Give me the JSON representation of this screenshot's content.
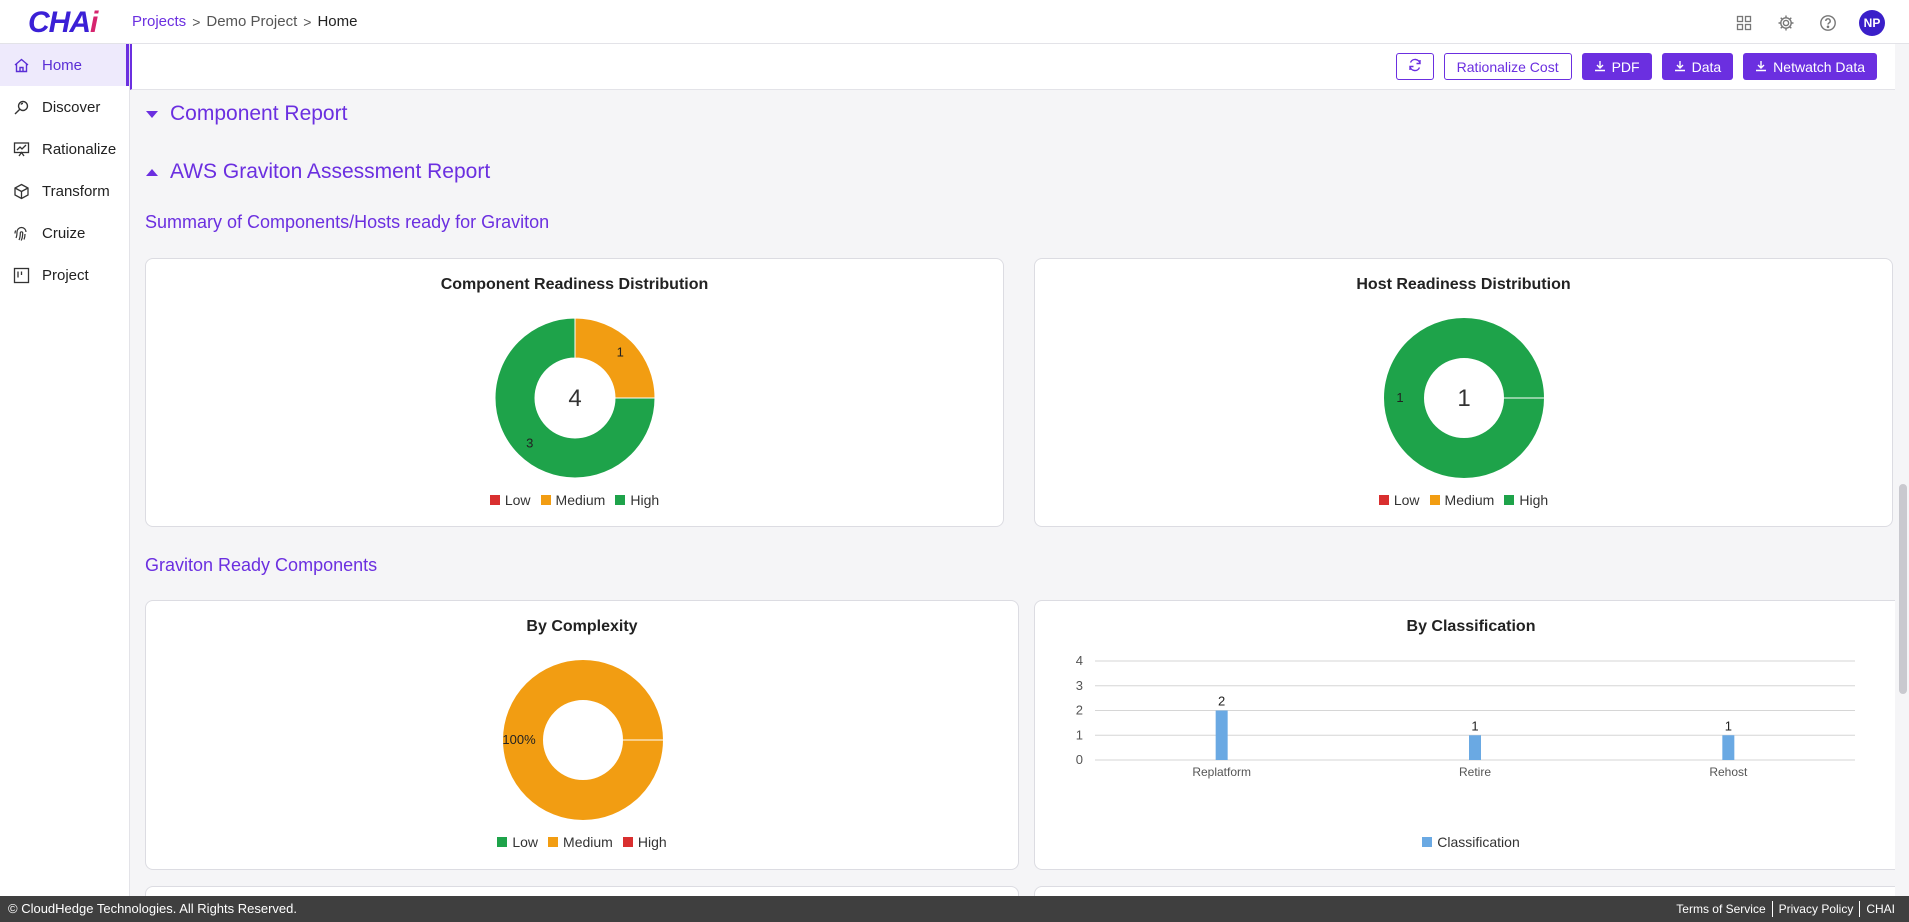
{
  "header": {
    "logo": {
      "main": "CHA",
      "accent": "i"
    },
    "breadcrumb": [
      "Projects",
      "Demo Project",
      "Home"
    ],
    "avatar_initials": "NP",
    "icons": [
      "grid-icon",
      "gear-icon",
      "help-icon"
    ]
  },
  "sidebar": {
    "items": [
      {
        "label": "Home",
        "icon": "home-icon",
        "active": true
      },
      {
        "label": "Discover",
        "icon": "discover-icon",
        "active": false
      },
      {
        "label": "Rationalize",
        "icon": "rationalize-icon",
        "active": false
      },
      {
        "label": "Transform",
        "icon": "cube-icon",
        "active": false
      },
      {
        "label": "Cruize",
        "icon": "fingerprint-icon",
        "active": false
      },
      {
        "label": "Project",
        "icon": "board-icon",
        "active": false
      }
    ]
  },
  "toolbar": {
    "refresh_icon": "refresh-icon",
    "rationalize_cost": "Rationalize Cost",
    "pdf": "PDF",
    "data": "Data",
    "netwatch": "Netwatch Data"
  },
  "sections": {
    "component_report": "Component Report",
    "graviton_report": "AWS Graviton Assessment Report",
    "summary_heading": "Summary of Components/Hosts ready for Graviton",
    "ready_heading": "Graviton Ready Components"
  },
  "colors": {
    "accent": "#6b2fe0",
    "low": "#d92f2f",
    "medium": "#f29d12",
    "high": "#1ea34a",
    "bar": "#6aa9e3"
  },
  "chart_data": [
    {
      "type": "pie",
      "title": "Component Readiness Distribution",
      "center_label": "4",
      "categories": [
        "Low",
        "Medium",
        "High"
      ],
      "values": [
        0,
        1,
        3
      ],
      "slice_labels": [
        "",
        "1",
        "3"
      ],
      "colors": [
        "#d92f2f",
        "#f29d12",
        "#1ea34a"
      ]
    },
    {
      "type": "pie",
      "title": "Host Readiness Distribution",
      "center_label": "1",
      "categories": [
        "Low",
        "Medium",
        "High"
      ],
      "values": [
        0,
        0,
        1
      ],
      "slice_labels": [
        "",
        "",
        "1"
      ],
      "colors": [
        "#d92f2f",
        "#f29d12",
        "#1ea34a"
      ]
    },
    {
      "type": "pie",
      "title": "By Complexity",
      "categories": [
        "Low",
        "Medium",
        "High"
      ],
      "values": [
        0,
        100,
        0
      ],
      "slice_labels": [
        "",
        "100%",
        ""
      ],
      "colors": [
        "#1ea34a",
        "#f29d12",
        "#d92f2f"
      ]
    },
    {
      "type": "bar",
      "title": "By Classification",
      "categories": [
        "Replatform",
        "Retire",
        "Rehost"
      ],
      "series": [
        {
          "name": "Classification",
          "values": [
            2,
            1,
            1
          ]
        }
      ],
      "ylim": [
        0,
        4
      ],
      "yticks": [
        "0",
        "1",
        "2",
        "3",
        "4"
      ],
      "grid": true,
      "legend": "bottom"
    }
  ],
  "footer": {
    "copyright": "© CloudHedge Technologies. All Rights Reserved.",
    "links": [
      "Terms of Service",
      "Privacy Policy",
      "CHAI"
    ]
  }
}
